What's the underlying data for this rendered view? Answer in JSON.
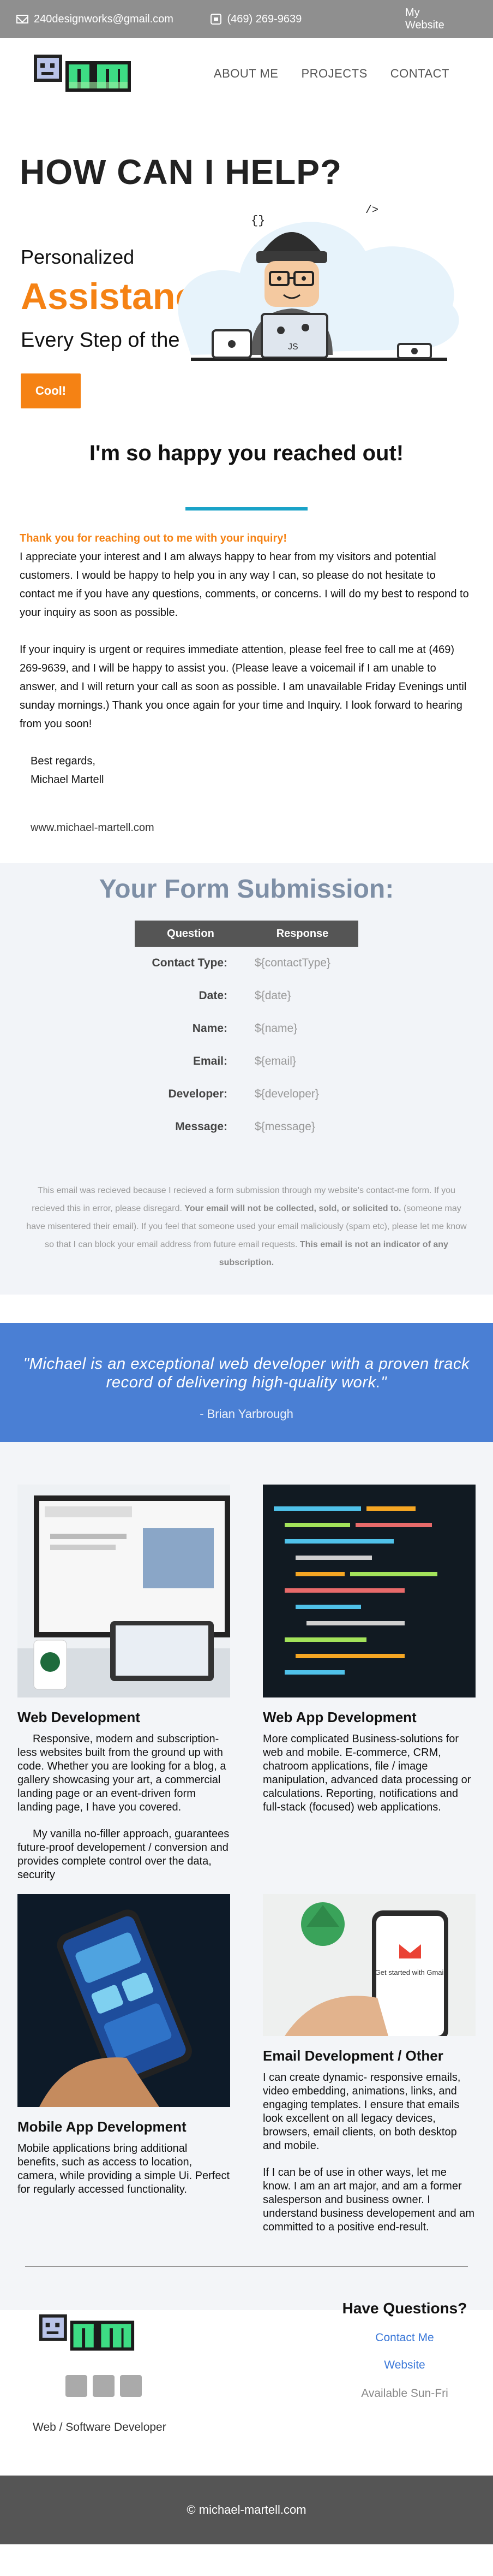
{
  "topbar": {
    "email": "240designworks@gmail.com",
    "phone": "(469) 269-9639",
    "site": "My Website"
  },
  "nav": {
    "links": [
      "ABOUT ME",
      "PROJECTS",
      "CONTACT"
    ]
  },
  "hero": {
    "title": "HOW CAN I HELP?",
    "line1": "Personalized",
    "line2": "Assistance",
    "line3": "Every Step of the Way",
    "button": "Cool!"
  },
  "intro": {
    "heading": "I'm so happy you reached out!",
    "thanks": "Thank you for reaching out to me with your inquiry!",
    "para1": "I appreciate your interest and I am always happy to hear from my visitors and potential customers. I would be happy to help you in any way I can, so please do not hesitate to contact me if you have any questions, comments, or concerns. I will do my best to respond to your inquiry as soon as possible.",
    "para2": "If your inquiry is urgent or requires immediate attention, please feel free to call me at (469) 269-9639, and I will be happy to assist you. (Please leave a voicemail if I am unable to answer, and I will return your call as soon as possible. I am unavailable Friday Evenings until sunday mornings.) Thank you once again for your time and Inquiry. I look forward to hearing from you soon!",
    "regards": "Best regards,",
    "name": "Michael Martell",
    "url": "www.michael-martell.com"
  },
  "form": {
    "title": "Your Form Submission:",
    "col_question": "Question",
    "col_response": "Response",
    "rows": [
      {
        "k": "Contact Type:",
        "v": "${contactType}"
      },
      {
        "k": "Date:",
        "v": "${date}"
      },
      {
        "k": "Name:",
        "v": "${name}"
      },
      {
        "k": "Email:",
        "v": "${email}"
      },
      {
        "k": "Developer:",
        "v": "${developer}"
      },
      {
        "k": "Message:",
        "v": "${message}"
      }
    ],
    "notice_a": "This email was recieved because I recieved a form submission through my website's contact-me form. If you recieved this in error, please disregard.",
    "notice_b": "Your email will not be collected, sold, or solicited to.",
    "notice_c": "(someone may have misentered their email). If you feel that someone used your email maliciously (spam etc), please let me know so that I can block your email address from future email requests.",
    "notice_d": "This email is not an indicator of any subscription."
  },
  "quote": {
    "text": "\"Michael is an exceptional web developer with a proven track record of delivering high-quality work.\"",
    "author": "- Brian Yarbrough"
  },
  "services": [
    {
      "title": "Web Development",
      "p1": "Responsive, modern and subscription-less websites built from the ground up with code. Whether you are looking for a blog, a gallery showcasing your art, a commercial landing page or an event-driven form landing page, I have you covered.",
      "p2": "My vanilla no-filler approach, guarantees future-proof developement / conversion and provides complete control over the data, security"
    },
    {
      "title": "Web App Development",
      "p1": "More complicated Business-solutions for web and mobile. E-commerce, CRM, chatroom applications, file / image manipulation, advanced data processing or calculations. Reporting, notifications and full-stack (focused) web applications.",
      "p2": ""
    },
    {
      "title": "Mobile App Development",
      "p1": "Mobile applications bring additional benefits, such as access to location, camera, while providing a simple Ui. Perfect for regularly accessed functionality.",
      "p2": ""
    },
    {
      "title": "Email Development / Other",
      "p1": "I can create dynamic- responsive emails, video embedding, animations, links, and engaging templates. I ensure that emails look excellent on all legacy devices, browsers, email clients, on both desktop and mobile.",
      "p2": "If I can be of use in other ways, let me know. I am an art major, and am a former salesperson and business owner. I understand business developement and am committed to a positive end-result."
    }
  ],
  "phone_screen": {
    "text": "Get started with Gmail"
  },
  "footer": {
    "tagline": "Web / Software Developer",
    "questions": "Have Questions?",
    "contact": "Contact Me",
    "website": "Website",
    "available": "Available Sun-Fri",
    "copyright": "© michael-martell.com"
  },
  "colors": {
    "accent": "#f58214",
    "rule": "#1aa3c8",
    "quote_bg": "#4a7fd4",
    "link": "#3b78d8"
  }
}
